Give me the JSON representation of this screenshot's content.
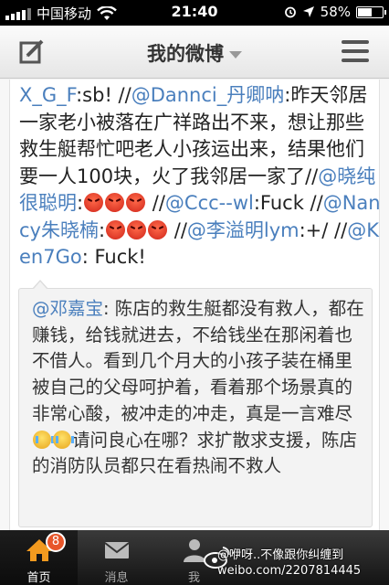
{
  "status_bar": {
    "carrier": "中国移动",
    "time": "21:40",
    "battery_pct": "58%",
    "battery_level": 0.58
  },
  "nav": {
    "title": "我的微博"
  },
  "post": {
    "cut_top": "",
    "seg1": "X_G_F",
    "seg2": ":sb! //",
    "seg3": "@Dannci_丹卿呐",
    "seg4": ":昨天邻居一家老小被落在广祥路出不来，想让那些救生艇帮忙吧老人小孩运出来，结果他们要一人100块，火了我邻居一家了//",
    "seg5": "@晓纯很聪明",
    "seg6": ":",
    "seg7": " //",
    "seg8": "@Ccc--wl",
    "seg9": ":Fuck //",
    "seg10": "@Nancy朱晓楠",
    "seg11": ":",
    "seg12": " //",
    "seg13": "@李溢明lym",
    "seg14": ":+/ //",
    "seg15": "@Ken7Go",
    "seg16": ": Fuck!"
  },
  "repost": {
    "author": "@邓嘉宝",
    "text1": ": 陈店的救生艇都没有救人，都在赚钱，给钱就进去，不给钱坐在那闲着也不借人。看到几个月大的小孩子装在桶里被自己的父母呵护着，看着那个场景真的非常心酸，被冲走的冲走，真是一言难尽",
    "text2": "请问良心在哪？求扩散求支援，陈店的消防队员都只在看热闹不救人"
  },
  "tabs": [
    {
      "label": "首页",
      "icon": "home-icon",
      "badge": "8"
    },
    {
      "label": "消息",
      "icon": "mail-icon"
    },
    {
      "label": "我",
      "icon": "person-icon"
    }
  ],
  "watermark": {
    "line1": "@咿呀..不像跟你纠缠到",
    "line2": "weibo.com/2207814445"
  },
  "colors": {
    "mention": "#4a7fbd",
    "badge": "#e8562a"
  }
}
